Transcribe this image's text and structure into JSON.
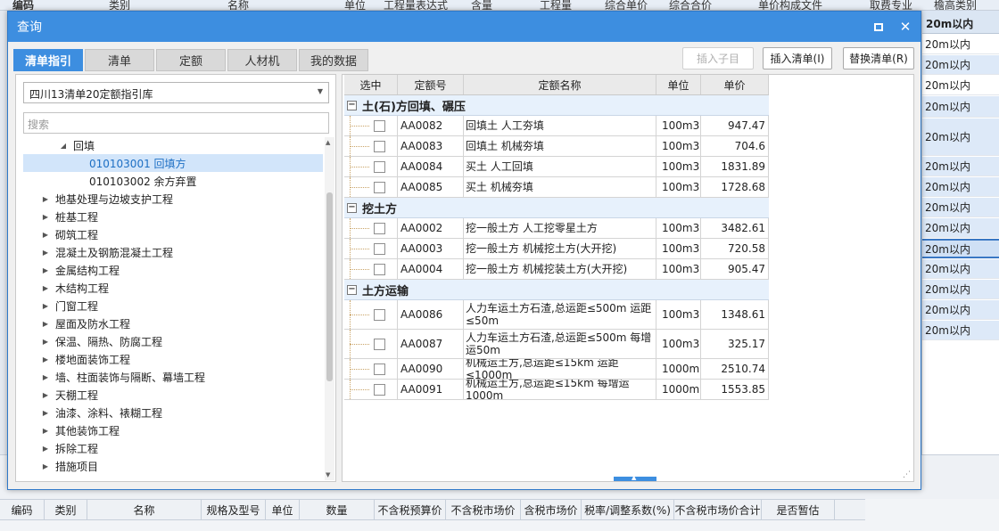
{
  "bg": {
    "top_headers": [
      "编码",
      "类别",
      "名称",
      "单位",
      "工程量表达式",
      "含量",
      "工程量",
      "综合单价",
      "综合合价",
      "单价构成文件",
      "取费专业",
      "檐高类别"
    ],
    "right_header": "20m以内",
    "right_rows": [
      "20m以内",
      "20m以内",
      "20m以内",
      "20m以内",
      "20m以内",
      "20m以内",
      "20m以内",
      "20m以内",
      "20m以内",
      "20m以内",
      "20m以内",
      "20m以内",
      "20m以内",
      "20m以内"
    ],
    "bottom_cols": [
      "编码",
      "类别",
      "名称",
      "规格及型号",
      "单位",
      "数量",
      "不含税预算价",
      "不含税市场价",
      "含税市场价",
      "税率/调整系数(%)",
      "不含税市场价合计",
      "是否暂估"
    ]
  },
  "dialog": {
    "title": "查询",
    "tabs": [
      {
        "label": "清单指引",
        "active": true
      },
      {
        "label": "清单",
        "active": false
      },
      {
        "label": "定额",
        "active": false
      },
      {
        "label": "人材机",
        "active": false
      },
      {
        "label": "我的数据",
        "active": false
      }
    ],
    "buttons": {
      "insert_child": "插入子目",
      "insert_list": "插入清单(I)",
      "replace_list": "替换清单(R)"
    },
    "library": "四川13清单20定额指引库",
    "search_placeholder": "搜索",
    "tree": [
      {
        "label": "回填",
        "level": 2,
        "expanded": true,
        "selected": false
      },
      {
        "label": "010103001  回填方",
        "level": 3,
        "expanded": false,
        "selected": true
      },
      {
        "label": "010103002  余方弃置",
        "level": 3,
        "expanded": false,
        "selected": false
      },
      {
        "label": "地基处理与边坡支护工程",
        "level": 1,
        "expanded": false,
        "selected": false
      },
      {
        "label": "桩基工程",
        "level": 1,
        "expanded": false,
        "selected": false
      },
      {
        "label": "砌筑工程",
        "level": 1,
        "expanded": false,
        "selected": false
      },
      {
        "label": "混凝土及钢筋混凝土工程",
        "level": 1,
        "expanded": false,
        "selected": false
      },
      {
        "label": "金属结构工程",
        "level": 1,
        "expanded": false,
        "selected": false
      },
      {
        "label": "木结构工程",
        "level": 1,
        "expanded": false,
        "selected": false
      },
      {
        "label": "门窗工程",
        "level": 1,
        "expanded": false,
        "selected": false
      },
      {
        "label": "屋面及防水工程",
        "level": 1,
        "expanded": false,
        "selected": false
      },
      {
        "label": "保温、隔热、防腐工程",
        "level": 1,
        "expanded": false,
        "selected": false
      },
      {
        "label": "楼地面装饰工程",
        "level": 1,
        "expanded": false,
        "selected": false
      },
      {
        "label": "墙、柱面装饰与隔断、幕墙工程",
        "level": 1,
        "expanded": false,
        "selected": false
      },
      {
        "label": "天棚工程",
        "level": 1,
        "expanded": false,
        "selected": false
      },
      {
        "label": "油漆、涂料、裱糊工程",
        "level": 1,
        "expanded": false,
        "selected": false
      },
      {
        "label": "其他装饰工程",
        "level": 1,
        "expanded": false,
        "selected": false
      },
      {
        "label": "拆除工程",
        "level": 1,
        "expanded": false,
        "selected": false
      },
      {
        "label": "措施项目",
        "level": 1,
        "expanded": false,
        "selected": false
      }
    ],
    "grid_headers": [
      "选中",
      "定额号",
      "定额名称",
      "单位",
      "单价"
    ],
    "groups": [
      {
        "title": "土(石)方回填、碾压",
        "rows": [
          {
            "code": "AA0082",
            "name": "回填土 人工夯填",
            "unit": "100m3",
            "price": "947.47"
          },
          {
            "code": "AA0083",
            "name": "回填土 机械夯填",
            "unit": "100m3",
            "price": "704.6"
          },
          {
            "code": "AA0084",
            "name": "买土 人工回填",
            "unit": "100m3",
            "price": "1831.89"
          },
          {
            "code": "AA0085",
            "name": "买土 机械夯填",
            "unit": "100m3",
            "price": "1728.68"
          }
        ]
      },
      {
        "title": "挖土方",
        "rows": [
          {
            "code": "AA0002",
            "name": "挖一般土方 人工挖零星土方",
            "unit": "100m3",
            "price": "3482.61"
          },
          {
            "code": "AA0003",
            "name": "挖一般土方 机械挖土方(大开挖)",
            "unit": "100m3",
            "price": "720.58"
          },
          {
            "code": "AA0004",
            "name": "挖一般土方 机械挖装土方(大开挖)",
            "unit": "100m3",
            "price": "905.47"
          }
        ]
      },
      {
        "title": "土方运输",
        "rows": [
          {
            "code": "AA0086",
            "name": "人力车运土方石渣,总运距≤500m 运距≤50m",
            "unit": "100m3",
            "price": "1348.61",
            "tall": true
          },
          {
            "code": "AA0087",
            "name": "人力车运土方石渣,总运距≤500m 每增运50m",
            "unit": "100m3",
            "price": "325.17",
            "tall": true
          },
          {
            "code": "AA0090",
            "name": "机械运土方,总运距≤15km 运距≤1000m",
            "unit": "1000m3",
            "price": "2510.74"
          },
          {
            "code": "AA0091",
            "name": "机械运土方,总运距≤15km 每增运1000m",
            "unit": "1000m3",
            "price": "1553.85"
          }
        ]
      }
    ]
  }
}
